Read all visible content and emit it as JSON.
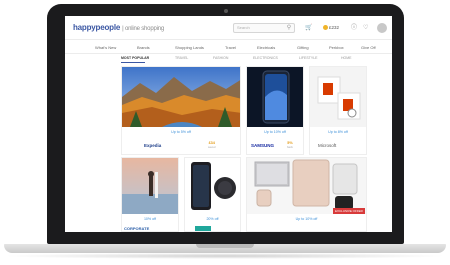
{
  "app": {
    "logo": "happypeople",
    "tagline": "| online shopping",
    "search_placeholder": "Search",
    "points": "£232"
  },
  "icons": {
    "search": "search-icon",
    "cart": "cart-icon",
    "coin": "coin-icon",
    "help": "help-icon",
    "notifications": "bell-icon",
    "avatar": "avatar"
  },
  "nav": [
    {
      "label": "What's New"
    },
    {
      "label": "Brands"
    },
    {
      "label": "Shopping Lands"
    },
    {
      "label": "Travel"
    },
    {
      "label": "Electricals"
    },
    {
      "label": "Gifting"
    },
    {
      "label": "Perkbox"
    },
    {
      "label": "Give Off"
    }
  ],
  "tabs": [
    {
      "label": "MOST POPULAR",
      "active": true
    },
    {
      "label": "TRAVEL"
    },
    {
      "label": "FASHION"
    },
    {
      "label": "ELECTRONICS"
    },
    {
      "label": "LIFESTYLE"
    },
    {
      "label": "HOME"
    }
  ],
  "cards": [
    {
      "caption": "Up to 5% off",
      "brand": "Expedia",
      "cashback": "£34",
      "cashback_note": "saved"
    },
    {
      "caption": "Up to 10% off",
      "brand": "SAMSUNG",
      "cashback": "5%",
      "cashback_note": "back"
    },
    {
      "caption": "Up to 8% off",
      "brand": "Microsoft",
      "cashback": "",
      "cashback_note": ""
    },
    {
      "caption": "10% off",
      "brand": "CORPORATE",
      "cashback": "",
      "cashback_note": ""
    },
    {
      "caption": "20% off",
      "brand": "",
      "cashback": "",
      "cashback_note": ""
    },
    {
      "caption": "Up to 10% off",
      "brand": "",
      "cashback": "",
      "cashback_note": "",
      "badge": "EXCLUSIVE OFFER"
    }
  ],
  "colors": {
    "brand_blue": "#3b57a3",
    "caption_blue": "#3b8fd8",
    "cashback_orange": "#e39a14",
    "badge_red": "#d83a3a",
    "bezel": "#1b1b1d"
  }
}
